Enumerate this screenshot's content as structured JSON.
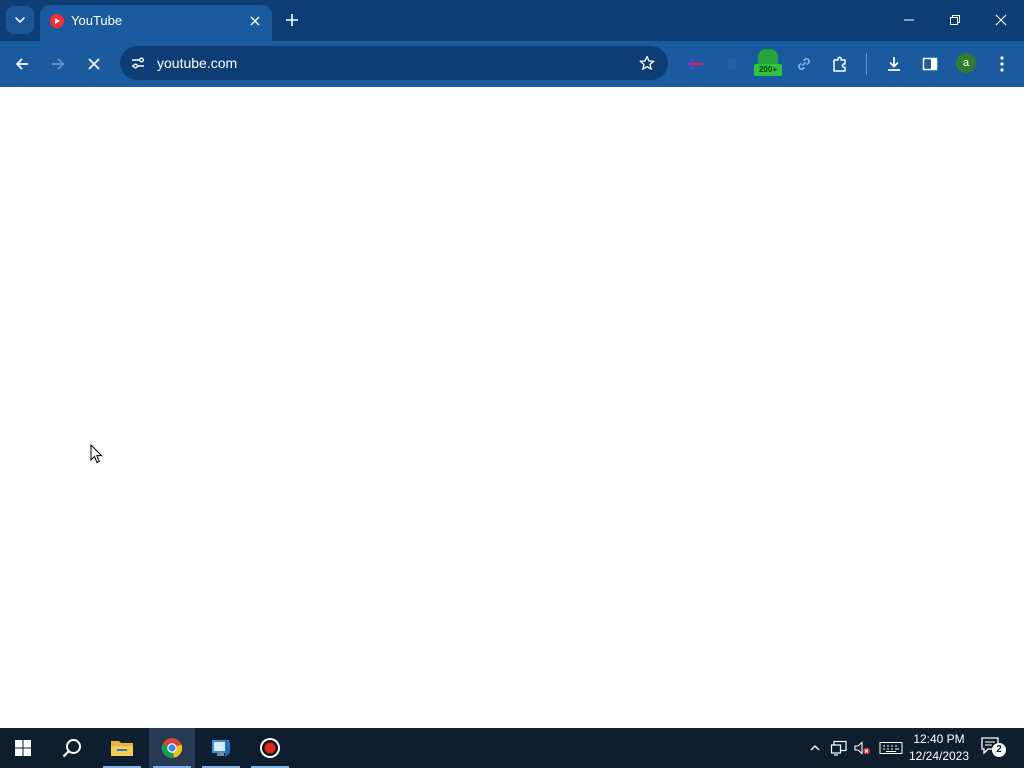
{
  "browser": {
    "tab": {
      "title": "YouTube",
      "favicon": "youtube-icon"
    },
    "address_bar": {
      "url": "youtube.com"
    },
    "extensions": [
      {
        "name": "arrow-extension-icon"
      },
      {
        "name": "extension-placeholder-icon"
      },
      {
        "name": "android-extension-icon",
        "badge": "200+"
      },
      {
        "name": "link-extension-icon"
      },
      {
        "name": "puzzle-extensions-icon"
      }
    ],
    "profile": {
      "initial": "a"
    }
  },
  "taskbar": {
    "apps": [
      "start-icon",
      "search-icon",
      "file-explorer-icon",
      "chrome-icon",
      "vscode-icon",
      "record-icon"
    ],
    "clock": {
      "time": "12:40 PM",
      "date": "12/24/2023"
    },
    "notifications": {
      "count": "2"
    }
  },
  "colors": {
    "titlebar": "#0d3d75",
    "toolbar": "#1a5a9e",
    "taskbar": "#0e1e2e",
    "youtube_red": "#ff2d2d"
  }
}
